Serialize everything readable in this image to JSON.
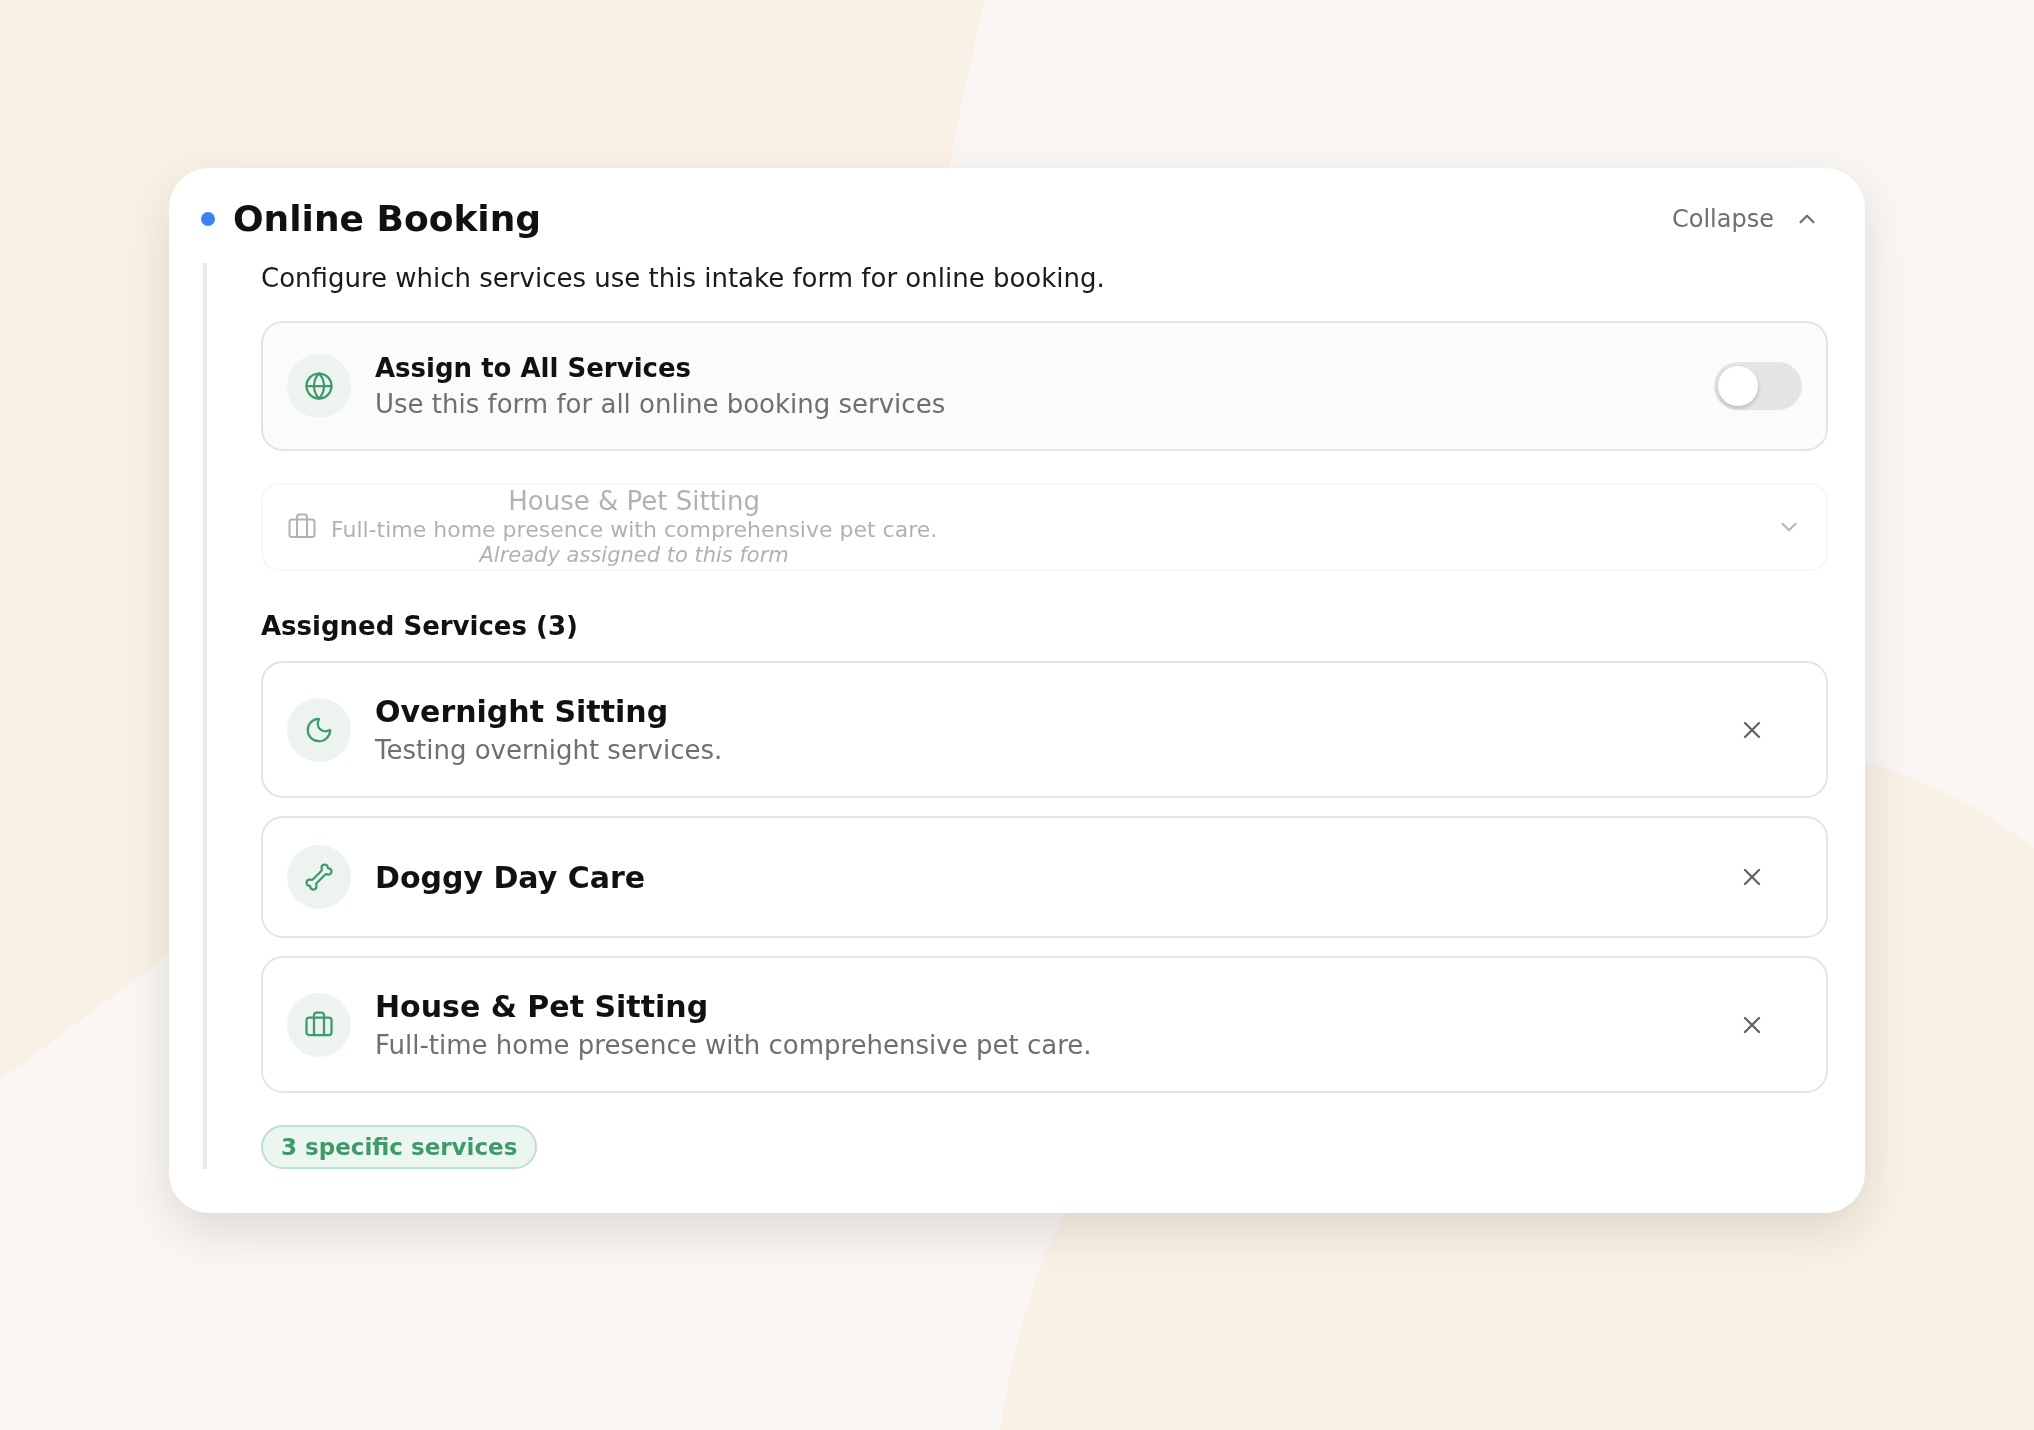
{
  "section": {
    "title": "Online Booking",
    "collapse_label": "Collapse",
    "expanded": true,
    "description": "Configure which services use this intake form for online booking.",
    "assign_all": {
      "title": "Assign to All Services",
      "subtitle": "Use this form for all online booking services",
      "on": false
    },
    "service_picker": {
      "title": "House & Pet Sitting",
      "description": "Full-time home presence with comprehensive pet care.",
      "note": "Already assigned to this form",
      "disabled": true
    },
    "assigned_heading": "Assigned Services (3)",
    "services": [
      {
        "name": "Overnight Sitting",
        "description": "Testing overnight services."
      },
      {
        "name": "Doggy Day Care"
      },
      {
        "name": "House & Pet Sitting",
        "description": "Full-time home presence with comprehensive pet care."
      }
    ],
    "badge": "3 specific services"
  }
}
